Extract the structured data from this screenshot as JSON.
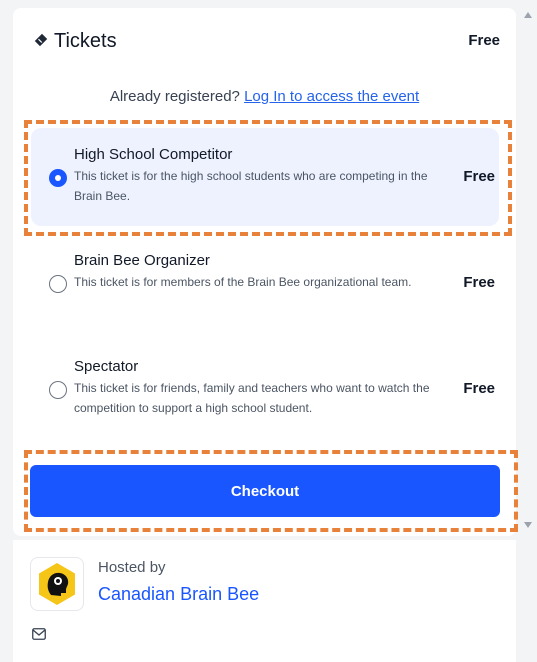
{
  "tickets_header": {
    "title": "Tickets",
    "price": "Free"
  },
  "login": {
    "prompt": "Already registered?",
    "link": "Log In to access the event"
  },
  "tickets": [
    {
      "name": "High School Competitor",
      "description": "This ticket is for the high school students who are competing in the Brain Bee.",
      "price": "Free",
      "selected": true
    },
    {
      "name": "Brain Bee Organizer",
      "description": "This ticket is for members of the Brain Bee organizational team.",
      "price": "Free",
      "selected": false
    },
    {
      "name": "Spectator",
      "description": "This ticket is for friends, family and teachers who want to watch the competition to support a high school student.",
      "price": "Free",
      "selected": false
    }
  ],
  "checkout": {
    "label": "Checkout"
  },
  "host": {
    "hosted_by": "Hosted by",
    "name": "Canadian Brain Bee"
  },
  "colors": {
    "accent": "#1a56ff",
    "selected_bg": "#eef2ff",
    "highlight_dash": "#e8823a"
  }
}
